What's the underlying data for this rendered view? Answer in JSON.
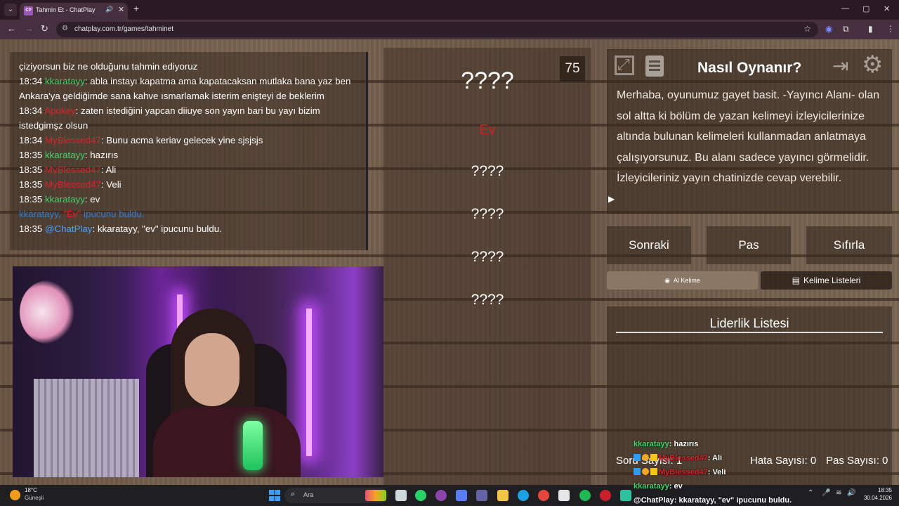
{
  "browser": {
    "tab_title": "Tahmin Et - ChatPlay",
    "tab_favicon": "CP",
    "tab_audio_icon": "speaker-icon",
    "url": "chatplay.com.tr/games/tahminet"
  },
  "chat": {
    "partial_top": "çiziyorsun biz ne olduğunu tahmin ediyoruz",
    "messages": [
      {
        "time": "18:34",
        "user": "kkaratayy",
        "user_color": "#3fd66c",
        "text": ": abla instayı kapatma ama kapatacaksan mutlaka bana yaz ben Ankara'ya geldiğimde sana kahve ısmarlamak isterim enişteyi de beklerim"
      },
      {
        "time": "18:34",
        "user": "Apokey",
        "user_color": "#d9232c",
        "text": ": zaten istediğini yapcan diiuye son yayın bari bu yayı bizim istedgimşz olsun"
      },
      {
        "time": "18:34",
        "user": "MyBlessed47",
        "user_color": "#d9232c",
        "text": ": Bunu acma keriav gelecek yine sjsjsjs"
      },
      {
        "time": "18:35",
        "user": "kkaratayy",
        "user_color": "#3fd66c",
        "text": ": hazırıs"
      },
      {
        "time": "18:35",
        "user": "MyBlessed47",
        "user_color": "#d9232c",
        "text": ": Ali"
      },
      {
        "time": "18:35",
        "user": "MyBlessed47",
        "user_color": "#d9232c",
        "text": ": Veli"
      },
      {
        "time": "18:35",
        "user": "kkaratayy",
        "user_color": "#3fd66c",
        "text": ": ev"
      }
    ],
    "system_line": {
      "user": "kkaratayy,",
      "hint": "\"Ev\"",
      "text": "ipucunu buldu."
    },
    "bot_line": {
      "time": "18:35",
      "user": "@ChatPlay",
      "text": ": kkaratayy, \"ev\" ipucunu buldu."
    }
  },
  "game": {
    "timer": "75",
    "main_word": "????",
    "found_hint": "Ev",
    "hidden_hints": [
      "????",
      "????",
      "????",
      "????"
    ]
  },
  "howto": {
    "title": "Nasıl Oynanır?",
    "text": "Merhaba, oyunumuz gayet basit. -Yayıncı Alanı- olan sol altta ki bölüm de yazan kelimeyi izleyicilerinize altında bulunan kelimeleri kullanmadan anlatmaya çalışıyorsunuz. Bu alanı sadece yayıncı görmelidir. İzleyicileriniz yayın chatinizde cevap verebilir."
  },
  "actions": {
    "next": "Sonraki",
    "pass": "Pas",
    "reset": "Sıfırla",
    "ai_word": "Al Kelime",
    "word_lists": "Kelime Listeleri"
  },
  "leaderboard": {
    "title": "Liderlik Listesi",
    "question_count": "Soru Sayısı: 1",
    "error_count": "Hata Sayısı: 0",
    "pass_count": "Pas Sayısı: 0"
  },
  "overlay_chat": {
    "lines": [
      {
        "user": "kkaratayy",
        "user_color": "#3fd66c",
        "text": ": hazırıs",
        "badges": false
      },
      {
        "user": "MyBlessed47",
        "user_color": "#d9232c",
        "text": ": Ali",
        "badges": true
      },
      {
        "user": "MyBlessed47",
        "user_color": "#d9232c",
        "text": ": Veli",
        "badges": true
      },
      {
        "user": "kkaratayy",
        "user_color": "#3fd66c",
        "text": ": ev",
        "badges": false
      },
      {
        "user": "@ChatPlay",
        "user_color": "#ffffff",
        "text": ": kkaratayy, \"ev\" ipucunu buldu.",
        "badges": false
      }
    ]
  },
  "taskbar": {
    "weather_temp": "18°C",
    "weather_desc": "Güneşli",
    "search_label": "Ara",
    "clock_time": "18:35",
    "clock_date": "30.04.2026"
  }
}
